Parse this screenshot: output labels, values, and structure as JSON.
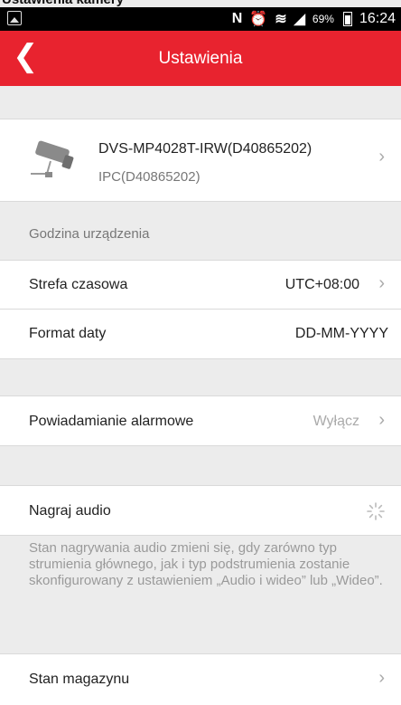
{
  "caption": "Ustawienia kamery",
  "status_bar": {
    "battery": "69%",
    "time": "16:24"
  },
  "header": {
    "title": "Ustawienia"
  },
  "device": {
    "name": "DVS-MP4028T-IRW(D40865202)",
    "subtitle": "IPC(D40865202)"
  },
  "section_time": {
    "heading": "Godzina urządzenia"
  },
  "settings": {
    "timezone_label": "Strefa czasowa",
    "timezone_value": "UTC+08:00",
    "date_format_label": "Format daty",
    "date_format_value": "DD-MM-YYYY",
    "alarm_label": "Powiadamianie alarmowe",
    "alarm_value": "Wyłącz",
    "audio_label": "Nagraj audio",
    "audio_note": "Stan nagrywania audio zmieni się, gdy zarówno typ strumienia głównego, jak i typ podstrumienia zostanie skonfigurowany z ustawieniem „Audio i wideo” lub „Wideo”.",
    "storage_label": "Stan magazynu"
  },
  "colors": {
    "accent": "#e8232f",
    "background": "#ececec"
  }
}
